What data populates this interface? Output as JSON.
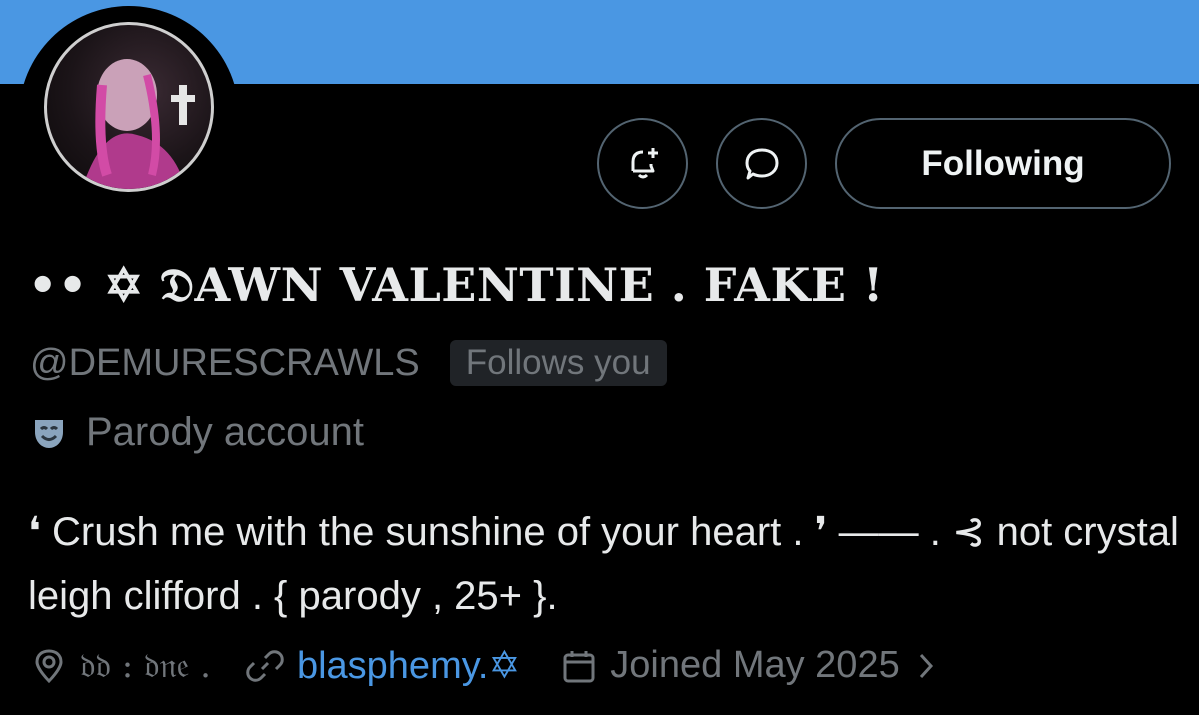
{
  "profile": {
    "display_name": "•• ✡ 𝔇AWN VALENTINE . FAKE !",
    "handle": "@DEMURESCRAWLS",
    "follows_you": "Follows you",
    "parody_label": "Parody account",
    "bio": "❛ Crush me with the sunshine of your heart . ❜ —— . ⊰ not crystal leigh clifford . { parody , 25+ }.",
    "location": "𝔡𝔡 : 𝔡𝔫𝔢 .",
    "website": "blasphemy.✡",
    "joined": "Joined May 2025"
  },
  "actions": {
    "follow_label": "Following"
  },
  "icons": {
    "notify": "bell-plus-icon",
    "message": "message-bubble-icon",
    "parody": "theater-mask-icon",
    "location": "location-pin-icon",
    "link": "link-icon",
    "calendar": "calendar-icon",
    "chevron": "chevron-right-icon"
  },
  "colors": {
    "banner": "#4a97e3",
    "accent_link": "#4a97e3",
    "muted_text": "#71767b",
    "border": "#536471"
  }
}
